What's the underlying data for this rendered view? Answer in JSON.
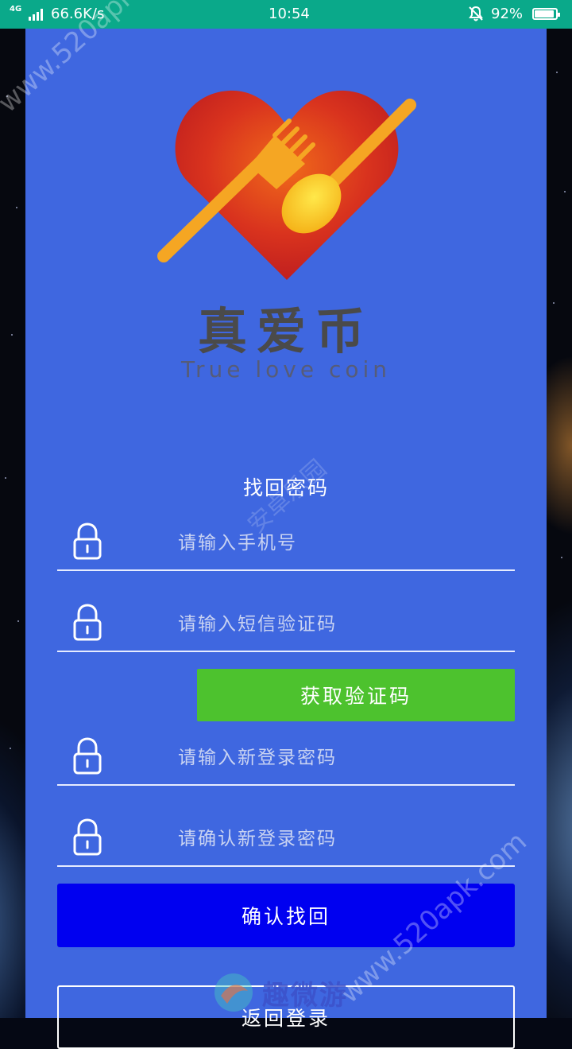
{
  "status_bar": {
    "network": "4G",
    "speed": "66.6K/s",
    "time": "10:54",
    "battery": "92%",
    "battery_level": 0.92
  },
  "brand": {
    "name_cn": "真爱币",
    "name_en": "True love coin"
  },
  "form": {
    "title": "找回密码",
    "phone_placeholder": "请输入手机号",
    "sms_placeholder": "请输入短信验证码",
    "get_code_label": "获取验证码",
    "new_password_placeholder": "请输入新登录密码",
    "confirm_password_placeholder": "请确认新登录密码",
    "confirm_label": "确认找回",
    "back_label": "返回登录"
  },
  "watermarks": {
    "site_url": "www.520apk.com",
    "site_cn": "安卓乐园",
    "site_logo_text": "趣微游"
  },
  "colors": {
    "status_bar": "#0aa98a",
    "panel": "#3f67e0",
    "get_code_button": "#4dc22e",
    "confirm_button": "#0000f0"
  },
  "icons": [
    "lock-icon",
    "bell-mute-icon",
    "battery-icon",
    "signal-icon",
    "fork-icon",
    "spoon-icon",
    "heart-icon"
  ]
}
